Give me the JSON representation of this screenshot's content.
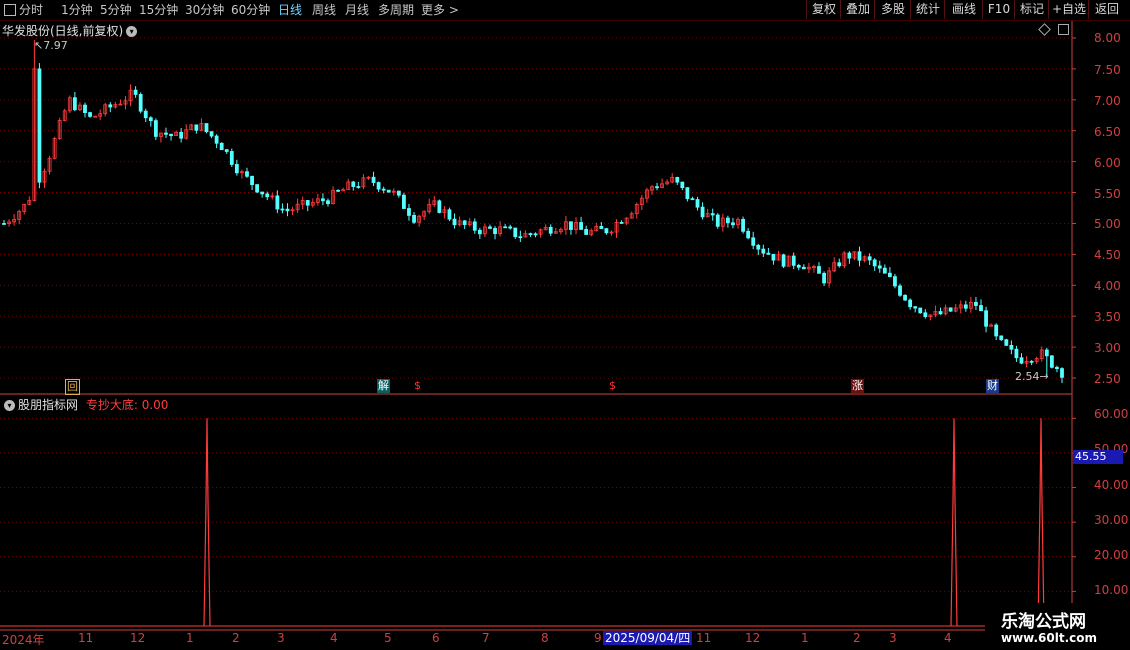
{
  "toolbar": {
    "periods": [
      "分时",
      "1分钟",
      "5分钟",
      "15分钟",
      "30分钟",
      "60分钟",
      "日线",
      "周线",
      "月线",
      "多周期",
      "更多 >"
    ],
    "active_period": "日线",
    "buttons": [
      "复权",
      "叠加",
      "多股",
      "统计",
      "画线",
      "F10",
      "标记",
      "+自选",
      "返回"
    ]
  },
  "main_chart": {
    "title": "华发股份(日线,前复权)",
    "high_label": "7.97",
    "low_label": "2.54",
    "y_ticks": [
      "8.00",
      "7.50",
      "7.00",
      "6.50",
      "6.00",
      "5.50",
      "5.00",
      "4.50",
      "4.00",
      "3.50",
      "3.00",
      "2.50"
    ],
    "markers": [
      {
        "text": "回",
        "color": "#e0b050"
      },
      {
        "text": "解",
        "color": "#60d0d0"
      },
      {
        "text": "$",
        "color": "#ff3030"
      },
      {
        "text": "$",
        "color": "#ff3030"
      },
      {
        "text": "涨",
        "color": "#ff6060"
      },
      {
        "text": "财",
        "color": "#60a0ff"
      }
    ]
  },
  "sub_chart": {
    "title": "股朋指标网",
    "indicator": "专抄大底: 0.00",
    "y_ticks": [
      "60.00",
      "50.00",
      "40.00",
      "30.00",
      "20.00",
      "10.00"
    ],
    "current_value": "45.55"
  },
  "x_axis": {
    "labels": [
      "2024年",
      "11",
      "12",
      "1",
      "2",
      "3",
      "4",
      "5",
      "6",
      "7",
      "8",
      "9",
      "11",
      "12",
      "1",
      "2",
      "3",
      "4"
    ],
    "selected_date": "2025/09/04/四"
  },
  "watermark": {
    "line1": "乐淘公式网",
    "line2": "www.60lt.com"
  },
  "colors": {
    "up": "#ff3c3c",
    "down": "#54ffff",
    "grid": "#7a0000",
    "axis": "#d04040"
  },
  "chart_data": [
    {
      "type": "candlestick",
      "title": "华发股份(日线,前复权)",
      "ylim": [
        2.4,
        8.1
      ],
      "x_labels": [
        "2024年",
        "11",
        "12",
        "1",
        "2",
        "3",
        "4",
        "5",
        "6",
        "7",
        "8",
        "9",
        "11",
        "12",
        "1",
        "2",
        "3",
        "4"
      ],
      "approx_close_path": [
        5.0,
        5.3,
        6.0,
        7.0,
        6.7,
        6.9,
        7.1,
        6.5,
        6.4,
        6.6,
        6.3,
        5.8,
        5.5,
        5.2,
        5.3,
        5.4,
        5.6,
        5.7,
        5.5,
        5.1,
        5.3,
        5.0,
        4.9,
        4.9,
        4.8,
        4.9,
        5.0,
        4.85,
        4.9,
        5.2,
        5.6,
        5.7,
        5.3,
        5.0,
        5.05,
        4.6,
        4.4,
        4.35,
        4.1,
        4.5,
        4.4,
        4.1,
        3.7,
        3.5,
        3.6,
        3.7,
        3.1,
        2.8,
        2.9,
        2.6
      ],
      "high": 7.97,
      "low": 2.54
    },
    {
      "type": "line",
      "title": "专抄大底",
      "ylim": [
        0,
        65
      ],
      "spikes": [
        {
          "position": "2025-01",
          "value": 60
        },
        {
          "position": "2025-04",
          "value": 60
        },
        {
          "position": "2025-05",
          "value": 60
        }
      ],
      "current": 0.0
    }
  ]
}
